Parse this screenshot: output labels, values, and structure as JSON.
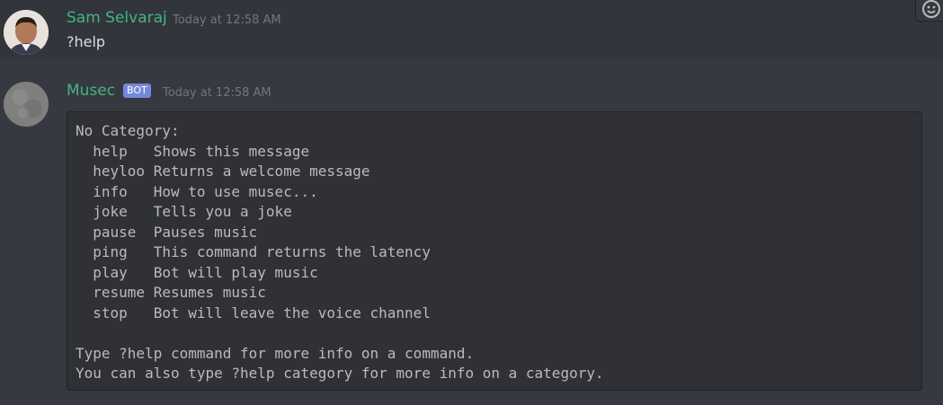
{
  "messages": [
    {
      "author": "Sam Selvaraj",
      "timestamp": "Today at 12:58 AM",
      "content": "?help"
    },
    {
      "author": "Musec",
      "badge": "BOT",
      "timestamp": "Today at 12:58 AM",
      "code": "No Category:\n  help   Shows this message\n  heyloo Returns a welcome message\n  info   How to use musec...\n  joke   Tells you a joke\n  pause  Pauses music\n  ping   This command returns the latency\n  play   Bot will play music\n  resume Resumes music\n  stop   Bot will leave the voice channel\n\nType ?help command for more info on a command.\nYou can also type ?help category for more info on a category."
    }
  ],
  "colors": {
    "background": "#36393f",
    "username": "#43b581",
    "bot_badge": "#7289da",
    "codeblock_bg": "#2f3136"
  },
  "icons": {
    "action": "add-reaction-icon"
  }
}
